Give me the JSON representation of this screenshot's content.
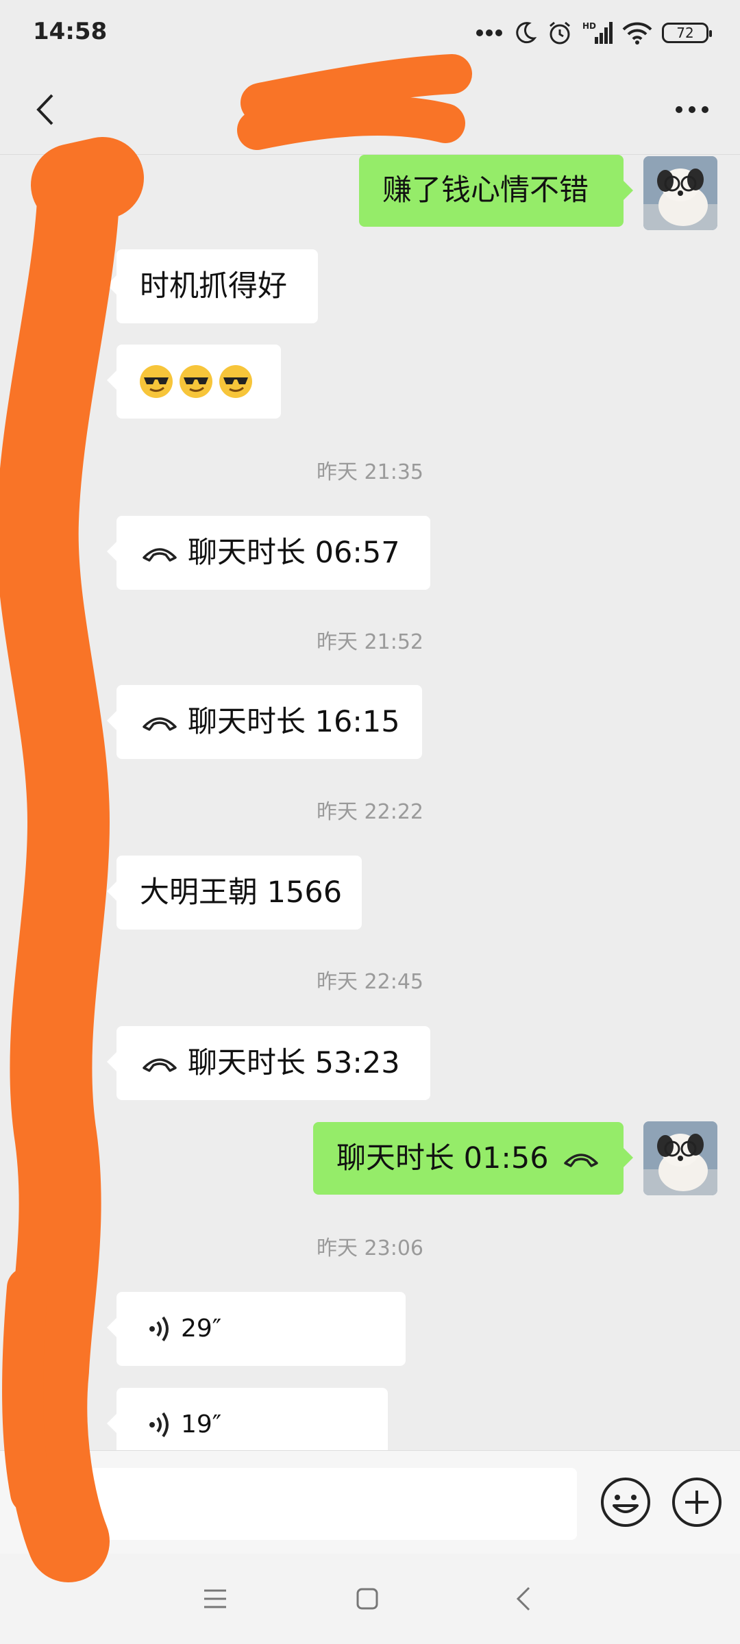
{
  "status_bar": {
    "time": "14:58",
    "battery": "72",
    "hd_label": "HD",
    "icons": [
      "more-dots-icon",
      "moon-icon",
      "alarm-icon",
      "signal-icon",
      "wifi-icon",
      "battery-icon"
    ]
  },
  "header": {
    "title": "",
    "back_icon": "chevron-left-icon",
    "more_icon": "more-dots-icon"
  },
  "messages": [
    {
      "side": "out",
      "type": "text",
      "text": "赚了钱心情不错"
    },
    {
      "side": "in",
      "type": "text",
      "text": "时机抓得好"
    },
    {
      "side": "in",
      "type": "emoji",
      "count": 3,
      "emoji_name": "cool-sunglasses-emoji"
    },
    {
      "type": "timestamp",
      "text": "昨天 21:35"
    },
    {
      "side": "in",
      "type": "call",
      "text": "聊天时长 06:57"
    },
    {
      "type": "timestamp",
      "text": "昨天 21:52"
    },
    {
      "side": "in",
      "type": "call",
      "text": "聊天时长 16:15"
    },
    {
      "type": "timestamp",
      "text": "昨天 22:22"
    },
    {
      "side": "in",
      "type": "text",
      "text": "大明王朝 1566"
    },
    {
      "type": "timestamp",
      "text": "昨天 22:45"
    },
    {
      "side": "in",
      "type": "call",
      "text": "聊天时长 53:23"
    },
    {
      "side": "out",
      "type": "call",
      "text": "聊天时长 01:56"
    },
    {
      "type": "timestamp",
      "text": "昨天 23:06"
    },
    {
      "side": "in",
      "type": "voice",
      "text": "29″"
    },
    {
      "side": "in",
      "type": "voice",
      "text": "19″"
    }
  ],
  "input_bar": {
    "voice_icon": "voice-input-icon",
    "emoji_icon": "emoji-icon",
    "plus_icon": "plus-circle-icon",
    "value": "",
    "placeholder": ""
  },
  "nav_bar": {
    "icons": [
      "menu-icon",
      "home-square-icon",
      "back-triangle-icon"
    ]
  },
  "colors": {
    "background": "#ededed",
    "incoming_bubble": "#ffffff",
    "outgoing_bubble": "#95ec69",
    "timestamp_text": "#9a9a9a",
    "redaction": "#f97427"
  }
}
